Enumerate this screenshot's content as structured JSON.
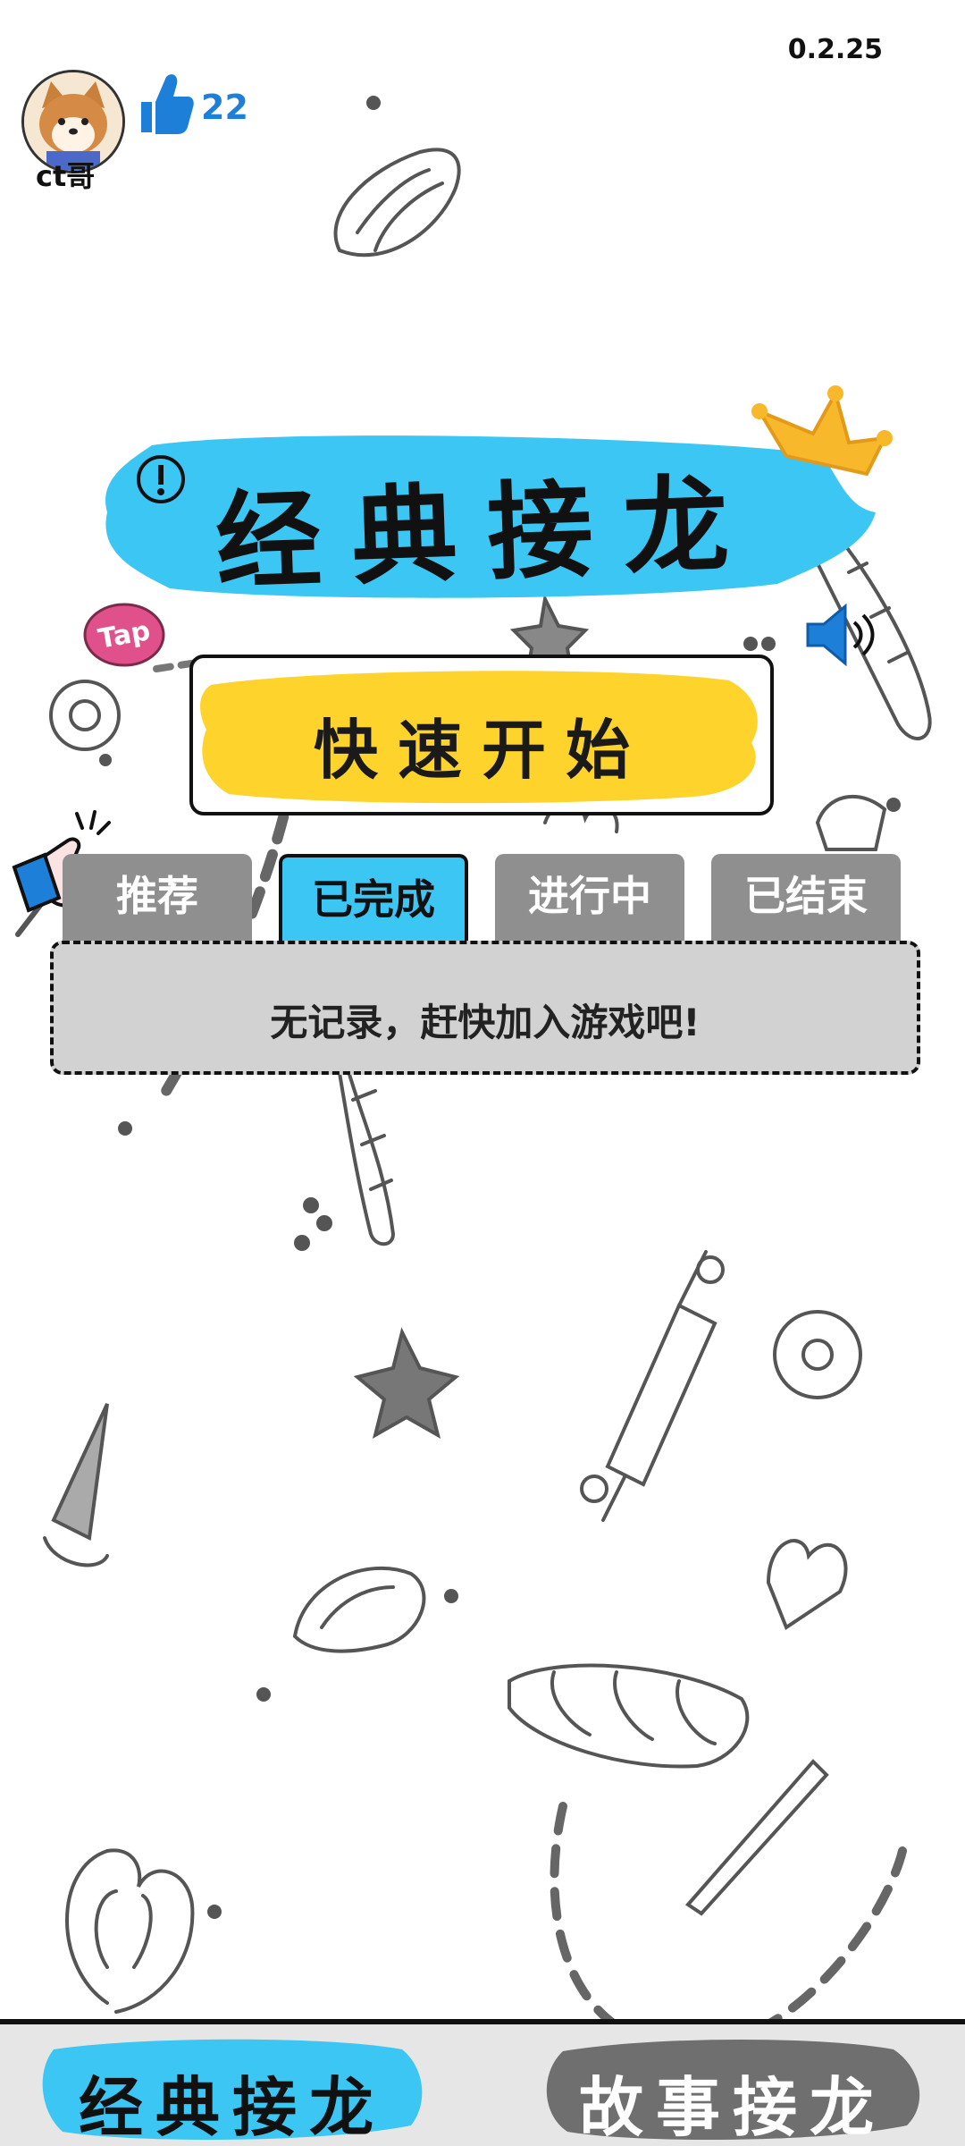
{
  "app": {
    "version": "0.2.25"
  },
  "user": {
    "name": "ct哥",
    "likes": "22"
  },
  "title": "经典接龙",
  "quick_start_label": "快速开始",
  "tabs": [
    {
      "label": "推荐",
      "active": false
    },
    {
      "label": "已完成",
      "active": true
    },
    {
      "label": "进行中",
      "active": false
    },
    {
      "label": "已结束",
      "active": false
    }
  ],
  "empty_message": "无记录，赶快加入游戏吧!",
  "bottom_nav": [
    {
      "label": "经典接龙",
      "active": true
    },
    {
      "label": "故事接龙",
      "active": false
    }
  ],
  "colors": {
    "accent_blue": "#3cc6f4",
    "accent_yellow": "#fdd32c",
    "like_blue": "#1e7fd8",
    "tab_gray": "#8f8f8f",
    "crown_gold": "#f7b82b",
    "tap_pink": "#e0508a"
  },
  "icons": [
    "info-icon",
    "crown-icon",
    "tap-badge-icon",
    "sound-icon",
    "thumbs-up-icon",
    "pointing-hand-icon"
  ]
}
